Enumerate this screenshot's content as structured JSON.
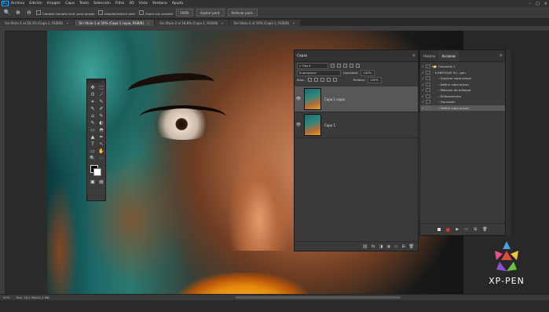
{
  "menubar": {
    "app_icon": "Ps",
    "items": [
      "Archivo",
      "Edición",
      "Imagen",
      "Capa",
      "Texto",
      "Selección",
      "Filtro",
      "3D",
      "Vista",
      "Ventana",
      "Ayuda"
    ],
    "window_controls": [
      "–",
      "□",
      "×"
    ]
  },
  "options": {
    "resize_windows": "Cambiar tamaño vent. para ajustar",
    "zoom_all": "Ampliar/reducir vent.",
    "scrubby_zoom": "Zoom con arrastre",
    "zoom_percent": "100%",
    "fit_screen": "Ajustar pant.",
    "fill_screen": "Rellenar pant."
  },
  "tabs": [
    {
      "label": "Sin título-1 al 28,3% (Capa 1, RGB/8)",
      "active": false
    },
    {
      "label": "Sin título-1 al 50% (Capa 1 copia, RGB/8)",
      "active": true
    },
    {
      "label": "Sin título-2 al 18,8% (Capa 1, RGB/8)",
      "active": false
    },
    {
      "label": "Sin título-1 al 50% (Capa 1, RGB/8)",
      "active": false
    }
  ],
  "status": {
    "zoom": "50%",
    "doc": "Doc: 16,2 MB/32,4 MB"
  },
  "toolbox": {
    "grip_left": "»",
    "grip_right": "×",
    "tools": [
      "✥",
      "⬚",
      "ʘ",
      "⟋",
      "⌗",
      "✎",
      "✎",
      "✐",
      "⌂",
      "✎",
      "✎",
      "◐",
      "▭",
      "◓",
      "▲",
      "✒",
      "T",
      "↖",
      "▭",
      "✋",
      "🔍",
      "⋯"
    ],
    "bottom": [
      "▣",
      "▤"
    ]
  },
  "layers_panel": {
    "title": "Capas",
    "filter_label": "Tipo",
    "blend_mode": "Superponer",
    "opacity_label": "Opacidad:",
    "opacity_value": "100%",
    "lock_label": "Bloq.:",
    "fill_label": "Relleno:",
    "fill_value": "100%",
    "layers": [
      {
        "name": "Capa 1 copia",
        "selected": true,
        "eye": "👁"
      },
      {
        "name": "Capa 1",
        "selected": false,
        "eye": "👁"
      }
    ],
    "footer_icons": [
      "⛓",
      "fx",
      "◨",
      "◑",
      "▭",
      "⊞",
      "🗑"
    ]
  },
  "actions_panel": {
    "tab_history": "Historia",
    "tab_actions": "Acciones",
    "items": [
      {
        "label": "Comando 1",
        "indent": 0,
        "selected": false
      },
      {
        "label": "ENFOQUE 50 - pen",
        "indent": 1,
        "selected": false
      },
      {
        "label": "Duplicar capa actual",
        "indent": 2,
        "selected": false
      },
      {
        "label": "Definir capa actual",
        "indent": 2,
        "selected": false
      },
      {
        "label": "Máscara de enfoque",
        "indent": 2,
        "selected": false
      },
      {
        "label": "Enfocamiento",
        "indent": 2,
        "selected": false
      },
      {
        "label": "Transición",
        "indent": 2,
        "selected": false
      },
      {
        "label": "Definir capa actual",
        "indent": 2,
        "selected": true
      }
    ],
    "footer_icons": [
      "■",
      "●",
      "▶",
      "▭",
      "⊞",
      "🗑"
    ]
  },
  "watermark": {
    "text": "XP-PEN"
  }
}
